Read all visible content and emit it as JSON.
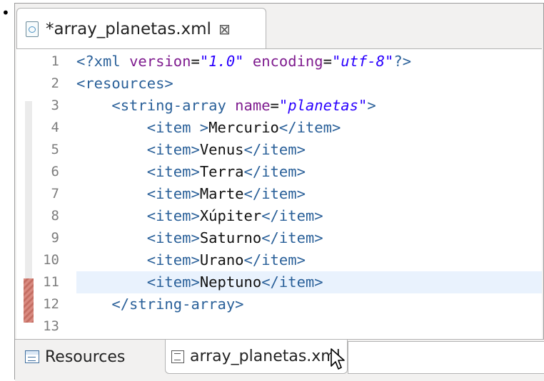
{
  "editor_tab": {
    "title": "*array_planetas.xml",
    "close_glyph": "⊠"
  },
  "lines": [
    {
      "n": "1",
      "parts": [
        {
          "c": "tag",
          "t": "<?xml "
        },
        {
          "c": "attr",
          "t": "version"
        },
        {
          "c": "txt",
          "t": "="
        },
        {
          "c": "val",
          "t": "\"1.0\""
        },
        {
          "c": "txt",
          "t": " "
        },
        {
          "c": "attr",
          "t": "encoding"
        },
        {
          "c": "txt",
          "t": "="
        },
        {
          "c": "val",
          "t": "\"utf-8\""
        },
        {
          "c": "tag",
          "t": "?>"
        }
      ]
    },
    {
      "n": "2",
      "parts": [
        {
          "c": "tag",
          "t": "<resources>"
        }
      ]
    },
    {
      "n": "3",
      "parts": [
        {
          "c": "txt",
          "t": "    "
        },
        {
          "c": "tag",
          "t": "<string-array "
        },
        {
          "c": "attr",
          "t": "name"
        },
        {
          "c": "txt",
          "t": "="
        },
        {
          "c": "val",
          "t": "\"planetas\""
        },
        {
          "c": "tag",
          "t": ">"
        }
      ]
    },
    {
      "n": "4",
      "parts": [
        {
          "c": "txt",
          "t": "        "
        },
        {
          "c": "tag",
          "t": "<item >"
        },
        {
          "c": "txt",
          "t": "Mercurio"
        },
        {
          "c": "tag",
          "t": "</item>"
        }
      ]
    },
    {
      "n": "5",
      "parts": [
        {
          "c": "txt",
          "t": "        "
        },
        {
          "c": "tag",
          "t": "<item>"
        },
        {
          "c": "txt",
          "t": "Venus"
        },
        {
          "c": "tag",
          "t": "</item>"
        }
      ]
    },
    {
      "n": "6",
      "parts": [
        {
          "c": "txt",
          "t": "        "
        },
        {
          "c": "tag",
          "t": "<item>"
        },
        {
          "c": "txt",
          "t": "Terra"
        },
        {
          "c": "tag",
          "t": "</item>"
        }
      ]
    },
    {
      "n": "7",
      "parts": [
        {
          "c": "txt",
          "t": "        "
        },
        {
          "c": "tag",
          "t": "<item>"
        },
        {
          "c": "txt",
          "t": "Marte"
        },
        {
          "c": "tag",
          "t": "</item>"
        }
      ]
    },
    {
      "n": "8",
      "parts": [
        {
          "c": "txt",
          "t": "        "
        },
        {
          "c": "tag",
          "t": "<item>"
        },
        {
          "c": "txt",
          "t": "Xúpiter"
        },
        {
          "c": "tag",
          "t": "</item>"
        }
      ]
    },
    {
      "n": "9",
      "parts": [
        {
          "c": "txt",
          "t": "        "
        },
        {
          "c": "tag",
          "t": "<item>"
        },
        {
          "c": "txt",
          "t": "Saturno"
        },
        {
          "c": "tag",
          "t": "</item>"
        }
      ]
    },
    {
      "n": "10",
      "parts": [
        {
          "c": "txt",
          "t": "        "
        },
        {
          "c": "tag",
          "t": "<item>"
        },
        {
          "c": "txt",
          "t": "Urano"
        },
        {
          "c": "tag",
          "t": "</item>"
        }
      ]
    },
    {
      "n": "11",
      "parts": [
        {
          "c": "txt",
          "t": "        "
        },
        {
          "c": "tag",
          "t": "<item>"
        },
        {
          "c": "txt",
          "t": "Neptuno"
        },
        {
          "c": "tag",
          "t": "</item>"
        }
      ]
    },
    {
      "n": "12",
      "parts": [
        {
          "c": "txt",
          "t": "    "
        },
        {
          "c": "tag",
          "t": "</string-array>"
        }
      ]
    },
    {
      "n": "13",
      "parts": []
    }
  ],
  "current_line": "11",
  "bottom_tabs": {
    "resources_label": "Resources",
    "source_label": "array_planetas.xml"
  },
  "colors": {
    "tag": "#2a6099",
    "attribute": "#7f1c8f",
    "value": "#2a00ff",
    "current_line": "#e9f2fd"
  },
  "icons": {
    "editor_tab": "xml-file-icon",
    "resources_tab": "resources-form-icon",
    "source_tab": "source-file-icon",
    "pointer": "mouse-pointer-icon"
  }
}
